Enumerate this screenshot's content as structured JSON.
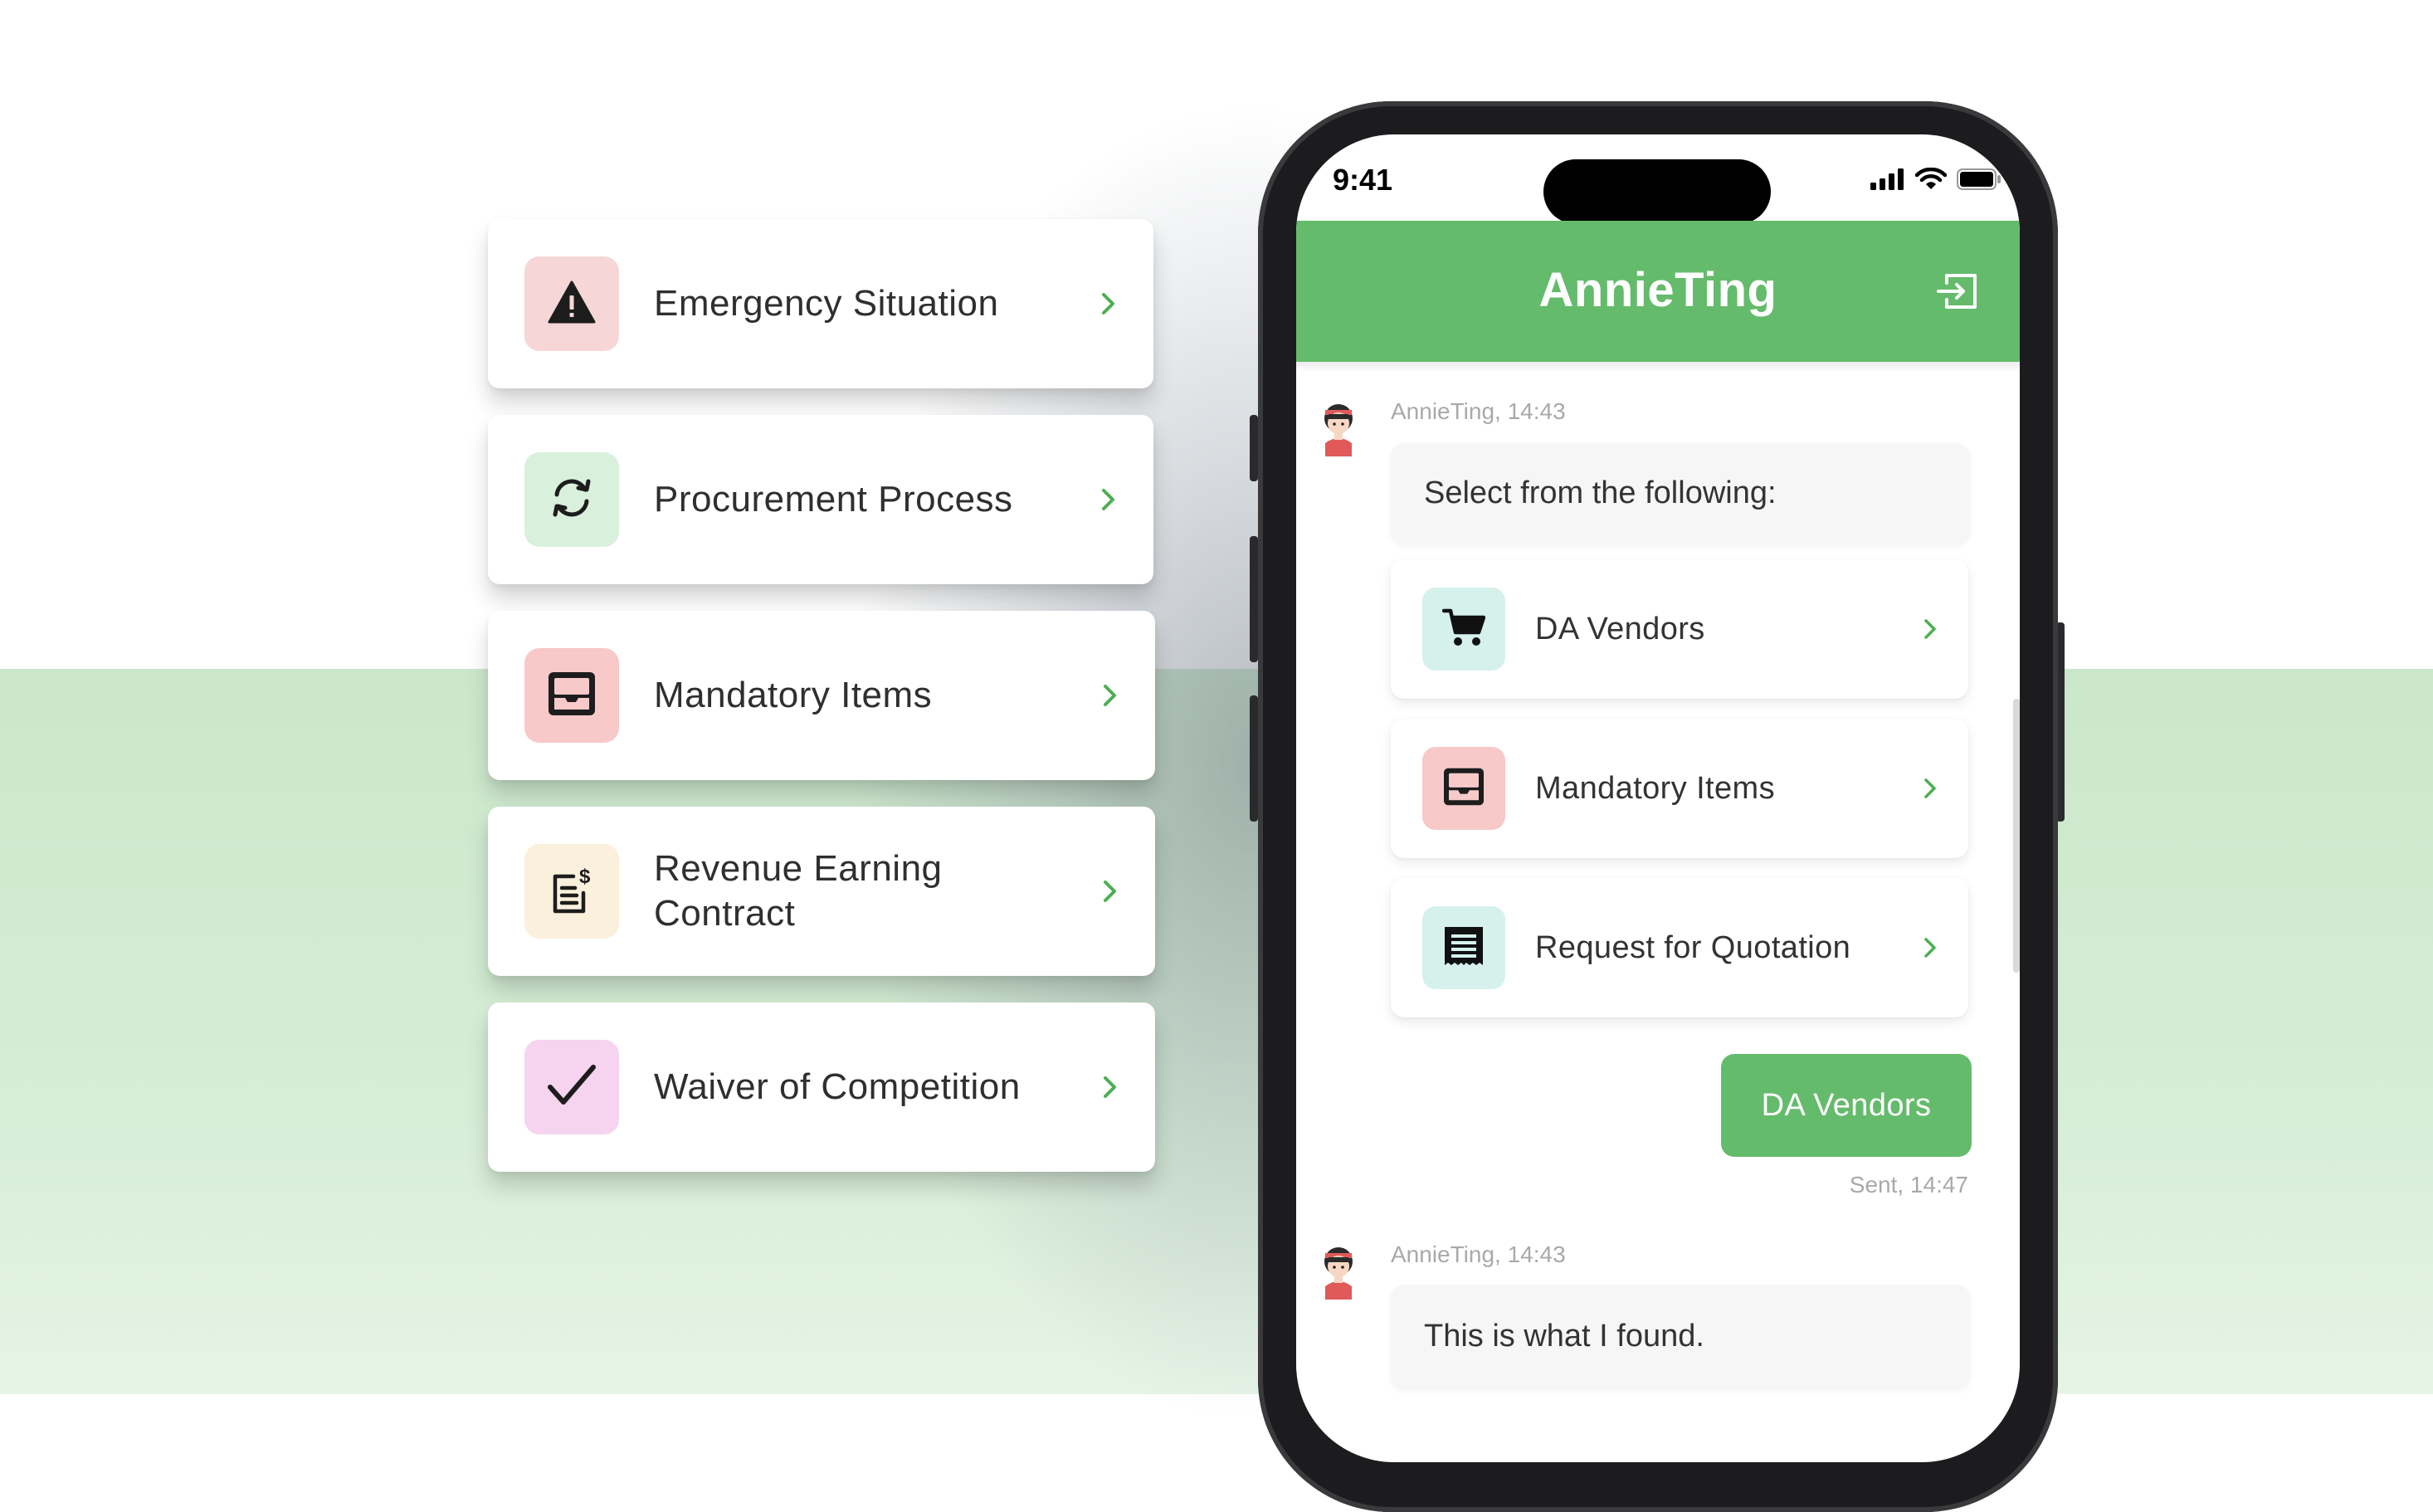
{
  "menu_cards": [
    {
      "label": "Emergency Situation",
      "icon": "warning-triangle-icon",
      "icon_bg": "#f6d6d6"
    },
    {
      "label": "Procurement Process",
      "icon": "sync-arrows-icon",
      "icon_bg": "#d9f1dc"
    },
    {
      "label": "Mandatory Items",
      "icon": "inbox-tray-icon",
      "icon_bg": "#f7c9c9"
    },
    {
      "label_line1": "Revenue Earning",
      "label_line2": "Contract",
      "icon": "invoice-dollar-icon",
      "icon_bg": "#fbf0dc"
    },
    {
      "label": "Waiver of Competition",
      "icon": "checkmark-icon",
      "icon_bg": "#f6d3ef"
    }
  ],
  "phone": {
    "status_time": "9:41",
    "header_title": "AnnieTing",
    "accent": "#65bb6c",
    "messages": [
      {
        "sender_meta": "AnnieTing, 14:43",
        "text": "Select from the following:"
      },
      {
        "sent_text": "DA Vendors",
        "sent_meta": "Sent, 14:47"
      },
      {
        "sender_meta": "AnnieTing, 14:43",
        "text": "This is what I found."
      }
    ],
    "options": [
      {
        "label": "DA Vendors",
        "icon": "shopping-cart-icon",
        "icon_bg": "#d6f1ec"
      },
      {
        "label": "Mandatory Items",
        "icon": "inbox-tray-icon",
        "icon_bg": "#f7c9c9"
      },
      {
        "label": "Request for Quotation",
        "icon": "receipt-icon",
        "icon_bg": "#d6f1ec"
      }
    ]
  }
}
